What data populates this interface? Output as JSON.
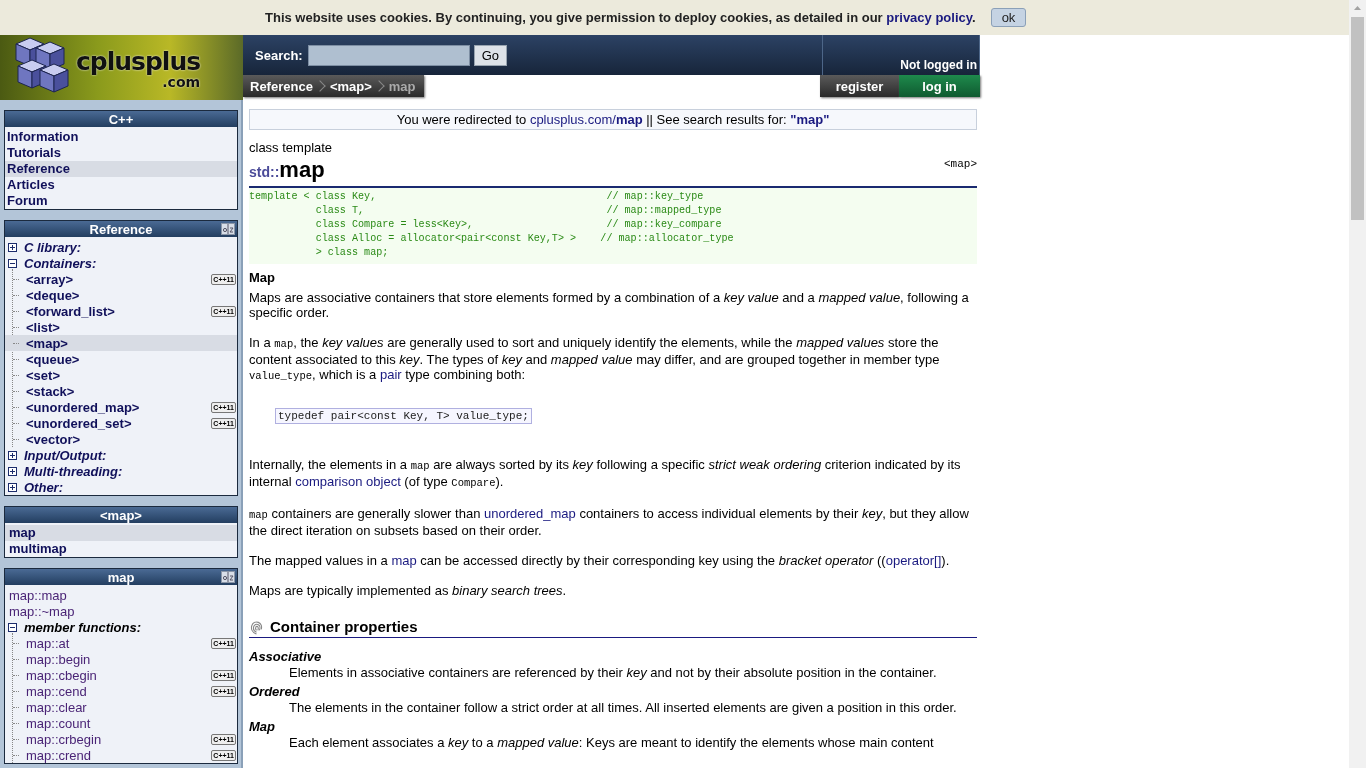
{
  "cookie_bar": {
    "segments": [
      {
        "kind": "text",
        "text": "This website uses cookies. By continuing, you give permission to deploy cookies, as detailed in our "
      },
      {
        "kind": "link",
        "text": "privacy policy"
      },
      {
        "kind": "text",
        "text": "."
      }
    ],
    "button": "ok"
  },
  "header": {
    "logo": {
      "name": "cplusplus",
      "domain": ".com"
    },
    "search": {
      "label": "Search:",
      "button": "Go"
    },
    "breadcrumbs": [
      {
        "label": "Reference",
        "current": false
      },
      {
        "label": "<map>",
        "current": false
      },
      {
        "label": "map",
        "current": true
      }
    ],
    "login_status": "Not logged in",
    "buttons": [
      {
        "label": "register",
        "kind": "register"
      },
      {
        "label": "log in",
        "kind": "login"
      }
    ]
  },
  "sidebar": [
    {
      "title": "C++",
      "kind": "menu",
      "sort_icon": false,
      "items": [
        {
          "label": "Information",
          "selected": false
        },
        {
          "label": "Tutorials",
          "selected": false
        },
        {
          "label": "Reference",
          "selected": true
        },
        {
          "label": "Articles",
          "selected": false
        },
        {
          "label": "Forum",
          "selected": false
        }
      ]
    },
    {
      "title": "Reference",
      "kind": "tree",
      "sort_icon": true,
      "items": [
        {
          "label": "C library:",
          "kind": "group",
          "expanded": false
        },
        {
          "label": "Containers:",
          "kind": "group",
          "expanded": true,
          "children": [
            {
              "label": "<array>",
              "badge": "C++11",
              "selected": false
            },
            {
              "label": "<deque>",
              "selected": false
            },
            {
              "label": "<forward_list>",
              "badge": "C++11",
              "selected": false
            },
            {
              "label": "<list>",
              "selected": false
            },
            {
              "label": "<map>",
              "selected": true
            },
            {
              "label": "<queue>",
              "selected": false
            },
            {
              "label": "<set>",
              "selected": false
            },
            {
              "label": "<stack>",
              "selected": false
            },
            {
              "label": "<unordered_map>",
              "badge": "C++11",
              "selected": false
            },
            {
              "label": "<unordered_set>",
              "badge": "C++11",
              "selected": false
            },
            {
              "label": "<vector>",
              "selected": false
            }
          ]
        },
        {
          "label": "Input/Output:",
          "kind": "group",
          "expanded": false
        },
        {
          "label": "Multi-threading:",
          "kind": "group",
          "expanded": false
        },
        {
          "label": "Other:",
          "kind": "group",
          "expanded": false
        }
      ]
    },
    {
      "title": "<map>",
      "kind": "menu",
      "sort_icon": false,
      "items": [
        {
          "label": "map",
          "selected": true
        },
        {
          "label": "multimap",
          "selected": false
        }
      ]
    },
    {
      "title": "map",
      "kind": "members",
      "sort_icon": true,
      "items": [
        {
          "label": "map::map",
          "kind": "leaf",
          "selected": false
        },
        {
          "label": "map::~map",
          "kind": "leaf",
          "selected": false
        },
        {
          "label": "member functions:",
          "kind": "group",
          "expanded": true,
          "children": [
            {
              "label": "map::at",
              "badge": "C++11",
              "selected": false
            },
            {
              "label": "map::begin",
              "selected": false
            },
            {
              "label": "map::cbegin",
              "badge": "C++11",
              "selected": false
            },
            {
              "label": "map::cend",
              "badge": "C++11",
              "selected": false
            },
            {
              "label": "map::clear",
              "selected": false
            },
            {
              "label": "map::count",
              "selected": false
            },
            {
              "label": "map::crbegin",
              "badge": "C++11",
              "selected": false
            },
            {
              "label": "map::crend",
              "badge": "C++11",
              "selected": false
            }
          ]
        }
      ]
    }
  ],
  "content": {
    "redirect": [
      {
        "kind": "text",
        "text": "You were redirected to "
      },
      {
        "kind": "link",
        "text": "cplusplus.com/**map**"
      },
      {
        "kind": "text",
        "text": " || See search results for: "
      },
      {
        "kind": "link",
        "text": "**\"map\"**"
      }
    ],
    "title": {
      "kind_label": "class template",
      "namespace": "std::",
      "name": "map",
      "header": "<map>"
    },
    "declaration": [
      "template < class Key,                                      // map::key_type",
      "           class T,                                        // map::mapped_type",
      "           class Compare = less<Key>,                      // map::key_compare",
      "           class Alloc = allocator<pair<const Key,T> >    // map::allocator_type",
      "           > class map;"
    ],
    "description": {
      "heading": "Map",
      "blocks": [
        {
          "kind": "para",
          "segments": [
            {
              "kind": "text",
              "text": "Maps are associative containers that store elements formed by a combination of a *key value* and a *mapped value*, following a specific order."
            }
          ]
        },
        {
          "kind": "para",
          "segments": [
            {
              "kind": "text",
              "text": "In a "
            },
            {
              "kind": "code",
              "text": "map"
            },
            {
              "kind": "text",
              "text": ", the *key values* are generally used to sort and uniquely identify the elements, while the *mapped values* store the content associated to this *key*. The types of *key* and *mapped value* may differ, and are grouped together in member type "
            },
            {
              "kind": "code",
              "text": "value_type"
            },
            {
              "kind": "text",
              "text": ", which is a "
            },
            {
              "kind": "link",
              "text": "pair"
            },
            {
              "kind": "text",
              "text": " type combining both:"
            }
          ]
        },
        {
          "kind": "code",
          "text": "typedef pair<const Key, T> value_type;"
        },
        {
          "kind": "para",
          "segments": [
            {
              "kind": "text",
              "text": "Internally, the elements in a "
            },
            {
              "kind": "code",
              "text": "map"
            },
            {
              "kind": "text",
              "text": " are always sorted by its *key* following a specific *strict weak ordering* criterion indicated by its internal "
            },
            {
              "kind": "link",
              "text": "comparison object"
            },
            {
              "kind": "text",
              "text": " (of type "
            },
            {
              "kind": "code",
              "text": "Compare"
            },
            {
              "kind": "text",
              "text": ")."
            }
          ]
        },
        {
          "kind": "para",
          "segments": [
            {
              "kind": "code",
              "text": "map"
            },
            {
              "kind": "text",
              "text": " containers are generally slower than "
            },
            {
              "kind": "link",
              "text": "unordered_map"
            },
            {
              "kind": "text",
              "text": " containers to access individual elements by their *key*, but they allow the direct iteration on subsets based on their order."
            }
          ]
        },
        {
          "kind": "para",
          "segments": [
            {
              "kind": "text",
              "text": "The mapped values in a "
            },
            {
              "kind": "link",
              "text": "map"
            },
            {
              "kind": "text",
              "text": " can be accessed directly by their corresponding key using the *bracket operator* (("
            },
            {
              "kind": "link",
              "text": "operator[]"
            },
            {
              "kind": "text",
              "text": ")."
            }
          ]
        },
        {
          "kind": "para",
          "segments": [
            {
              "kind": "text",
              "text": "Maps are typically implemented as *binary search trees*."
            }
          ]
        }
      ]
    },
    "properties": {
      "heading": "Container properties",
      "items": [
        {
          "term": "Associative",
          "definition": "Elements in associative containers are referenced by their *key* and not by their absolute position in the container."
        },
        {
          "term": "Ordered",
          "definition": "The elements in the container follow a strict order at all times. All inserted elements are given a position in this order."
        },
        {
          "term": "Map",
          "definition": "Each element associates a *key* to a *mapped value*: Keys are meant to identify the elements whose main content"
        }
      ]
    }
  }
}
